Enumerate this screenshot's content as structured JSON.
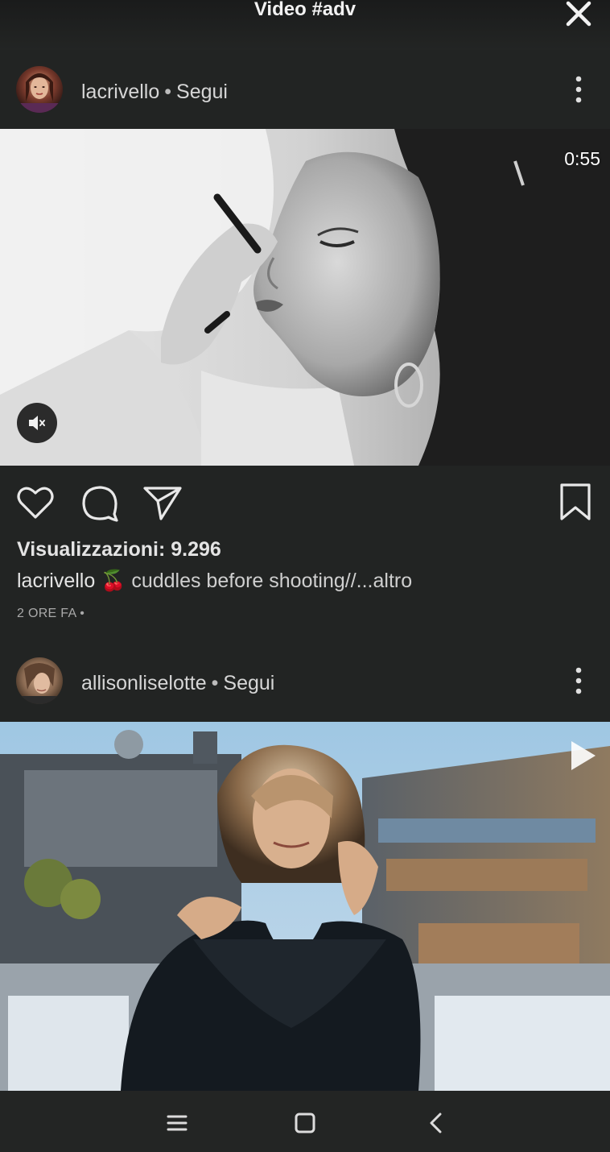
{
  "header": {
    "title": "Video #adv",
    "close_icon": "close-icon"
  },
  "posts": [
    {
      "username": "lacrivello",
      "separator": "•",
      "follow_label": "Segui",
      "duration": "0:55",
      "views_text": "Visualizzazioni: 9.296",
      "caption_user": "lacrivello",
      "caption_emoji": "🍒",
      "caption_text": "cuddles before shooting//...altro",
      "timestamp": "2 ORE FA •"
    },
    {
      "username": "allisonliselotte",
      "separator": "•",
      "follow_label": "Segui"
    }
  ],
  "icons": {
    "like": "heart-icon",
    "comment": "comment-icon",
    "share": "send-icon",
    "save": "bookmark-icon",
    "mute": "speaker-muted-icon",
    "more": "more-vertical-icon",
    "play": "play-icon"
  },
  "navbar": {
    "items": [
      "menu-icon",
      "home-square-icon",
      "back-icon"
    ]
  },
  "colors": {
    "background": "#222423",
    "text": "#e8e8e8",
    "muted_text": "#a9a9a9"
  }
}
